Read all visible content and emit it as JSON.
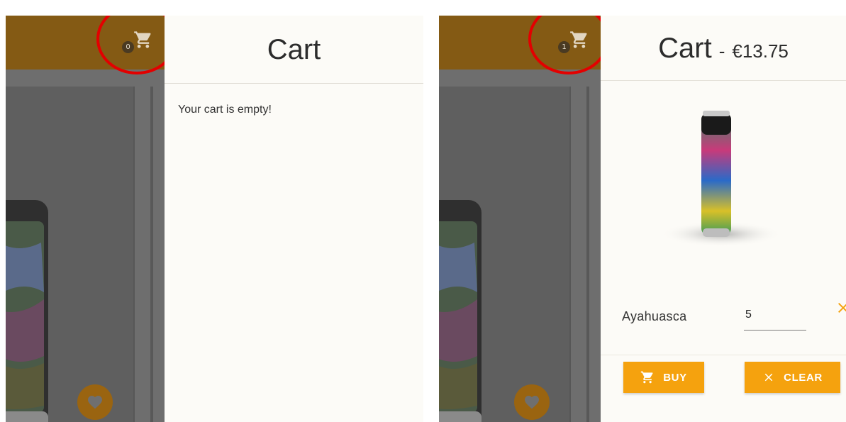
{
  "colors": {
    "accent": "#f5a20e",
    "appbar": "#845a14",
    "annotation": "#e30000",
    "drawer_bg": "#fcfbf7"
  },
  "left_state": {
    "cart_count": "0",
    "cart": {
      "title": "Cart",
      "empty_message": "Your cart is empty!"
    }
  },
  "right_state": {
    "cart_count": "1",
    "cart": {
      "title": "Cart",
      "separator": "-",
      "total": "€13.75",
      "items": [
        {
          "name": "Ayahuasca",
          "quantity": "5"
        }
      ],
      "actions": {
        "buy_label": "BUY",
        "clear_label": "CLEAR"
      }
    }
  },
  "icons": [
    "cart-icon",
    "heart-icon",
    "close-icon",
    "x-icon"
  ]
}
